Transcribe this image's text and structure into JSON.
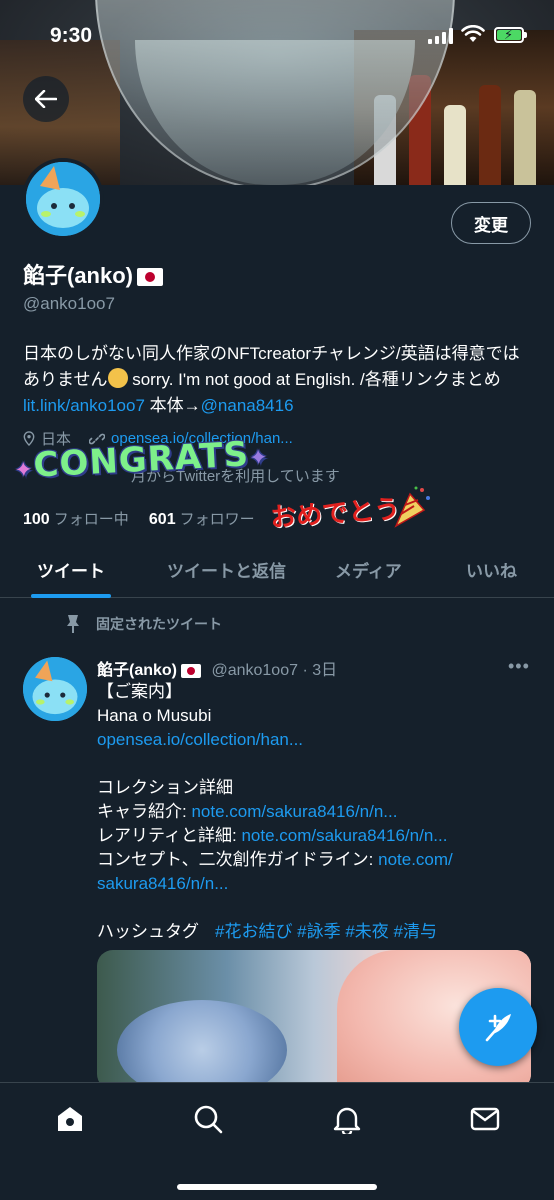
{
  "status_bar": {
    "time": "9:30"
  },
  "profile": {
    "edit_label": "変更",
    "display_name": "餡子(anko)",
    "handle": "@anko1oo7",
    "bio_text_1": "日本のしがない同人作家のNFTcreatorチャレンジ/英語は得意ではありません",
    "bio_text_2": " sorry. I'm not good at English. /各種リンクまとめ",
    "bio_link_1": "lit.link/anko1oo7",
    "bio_text_3": " 本体→",
    "bio_link_2": "@nana8416",
    "location": "日本",
    "website": "opensea.io/collection/han...",
    "joined": "月からTwitterを利用しています",
    "following_count": "100",
    "following_label": "フォロー中",
    "followers_count": "601",
    "followers_label": "フォロワー"
  },
  "stickers": {
    "congrats": "CONGRATS",
    "omedetou": "おめでとう"
  },
  "tabs": [
    {
      "label": "ツイート",
      "active": true
    },
    {
      "label": "ツイートと返信",
      "active": false
    },
    {
      "label": "メディア",
      "active": false
    },
    {
      "label": "いいね",
      "active": false
    }
  ],
  "pinned_label": "固定されたツイート",
  "tweet": {
    "name": "餡子(anko)",
    "handle_time": "@anko1oo7 · 3日",
    "line1": "【ご案内】",
    "line2": "Hana o Musubi",
    "line3_link": "opensea.io/collection/han...",
    "line4": "コレクション詳細",
    "line5_text": "キャラ紹介: ",
    "line5_link": "note.com/sakura8416/n/n...",
    "line6_text": "レアリティと詳細: ",
    "line6_link": "note.com/sakura8416/n/n...",
    "line7_text": "コンセプト、二次創作ガイドライン: ",
    "line7_link": "note.com/",
    "line8_link": "sakura8416/n/n...",
    "hashtag_label": "ハッシュタグ",
    "hashtags": "#花お結び #詠季 #未夜 #清与"
  },
  "colors": {
    "background": "#15202b",
    "accent": "#1d9bf0",
    "muted": "#8899a6",
    "border": "#38444d"
  }
}
